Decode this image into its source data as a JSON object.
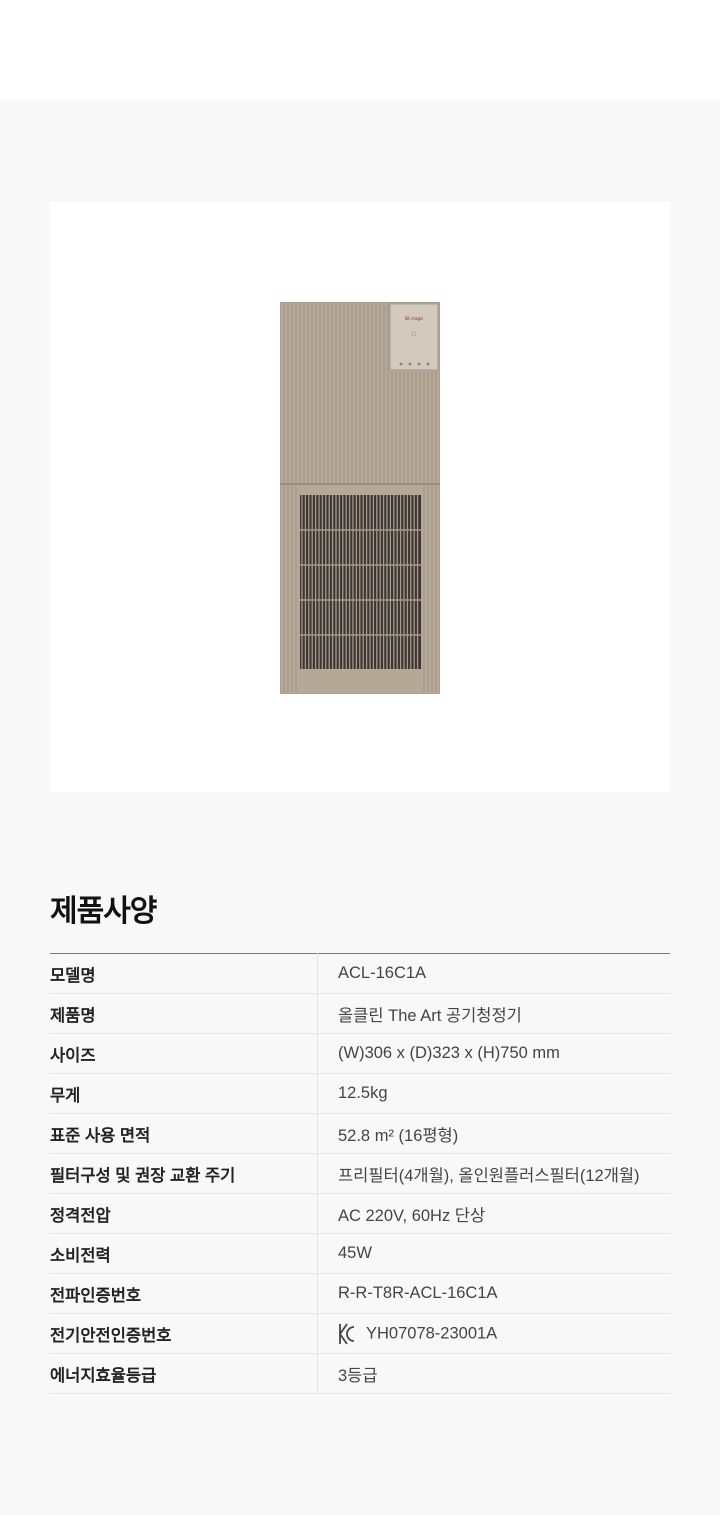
{
  "colors": {
    "page_bg": "#f8f8f8",
    "card_bg": "#ffffff",
    "product_body": "#b5a896",
    "vent": "#3b3632"
  },
  "product": {
    "image_name": "air-purifier-product-image",
    "badge_text": "SK magic"
  },
  "spec": {
    "title": "제품사양",
    "rows": [
      {
        "label": "모델명",
        "value": "ACL-16C1A"
      },
      {
        "label": "제품명",
        "value": "올클린 The Art 공기청정기"
      },
      {
        "label": "사이즈",
        "value": "(W)306 x (D)323 x (H)750 mm"
      },
      {
        "label": "무게",
        "value": "12.5kg"
      },
      {
        "label": "표준 사용 면적",
        "value": "52.8 m² (16평형)"
      },
      {
        "label": "필터구성 및 권장 교환 주기",
        "value": "프리필터(4개월), 올인원플러스필터(12개월)"
      },
      {
        "label": "정격전압",
        "value": "AC 220V, 60Hz 단상"
      },
      {
        "label": "소비전력",
        "value": "45W"
      },
      {
        "label": "전파인증번호",
        "value": "R-R-T8R-ACL-16C1A"
      },
      {
        "label": "전기안전인증번호",
        "value": "YH07078-23001A",
        "icon": "kc-certification-icon"
      },
      {
        "label": "에너지효율등급",
        "value": "3등급"
      }
    ]
  }
}
